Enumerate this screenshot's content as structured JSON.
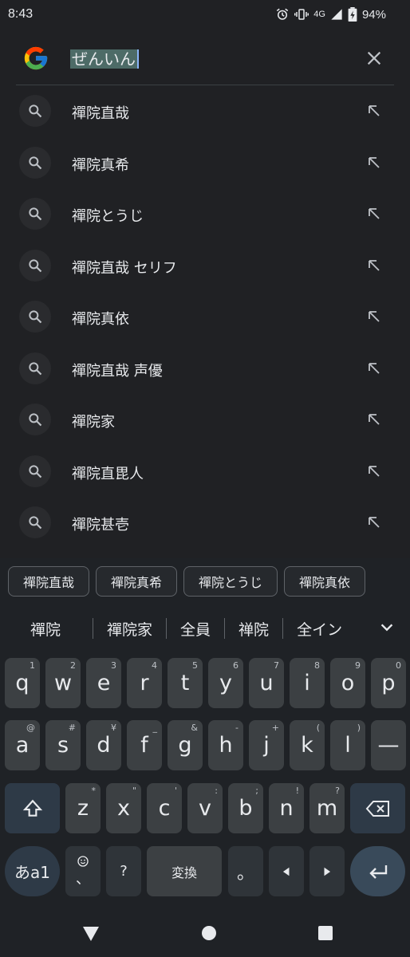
{
  "status": {
    "time": "8:43",
    "network": "4G",
    "battery": "94%"
  },
  "search": {
    "query": "ぜんいん"
  },
  "suggestions": [
    {
      "text": "禪院直哉"
    },
    {
      "text": "禪院真希"
    },
    {
      "text": "禪院とうじ"
    },
    {
      "text": "禪院直哉 セリフ"
    },
    {
      "text": "禪院真依"
    },
    {
      "text": "禪院直哉 声優"
    },
    {
      "text": "禪院家"
    },
    {
      "text": "禪院直毘人"
    },
    {
      "text": "禪院甚壱"
    }
  ],
  "keyboard": {
    "chips": [
      "禪院直哉",
      "禪院真希",
      "禪院とうじ",
      "禪院真依"
    ],
    "candidates": [
      "禪院",
      "禪院家",
      "全員",
      "禅院",
      "全イン"
    ],
    "row1": [
      {
        "k": "q",
        "h": "1"
      },
      {
        "k": "w",
        "h": "2"
      },
      {
        "k": "e",
        "h": "3"
      },
      {
        "k": "r",
        "h": "4"
      },
      {
        "k": "t",
        "h": "5"
      },
      {
        "k": "y",
        "h": "6"
      },
      {
        "k": "u",
        "h": "7"
      },
      {
        "k": "i",
        "h": "8"
      },
      {
        "k": "o",
        "h": "9"
      },
      {
        "k": "p",
        "h": "0"
      }
    ],
    "row2": [
      {
        "k": "a",
        "h": "@"
      },
      {
        "k": "s",
        "h": "#"
      },
      {
        "k": "d",
        "h": "¥"
      },
      {
        "k": "f",
        "h": "_"
      },
      {
        "k": "g",
        "h": "&"
      },
      {
        "k": "h",
        "h": "-"
      },
      {
        "k": "j",
        "h": "+"
      },
      {
        "k": "k",
        "h": "("
      },
      {
        "k": "l",
        "h": ")"
      },
      {
        "k": "—",
        "h": ""
      }
    ],
    "row3": [
      {
        "k": "z",
        "h": "*"
      },
      {
        "k": "x",
        "h": "\""
      },
      {
        "k": "c",
        "h": "'"
      },
      {
        "k": "v",
        "h": ":"
      },
      {
        "k": "b",
        "h": ";"
      },
      {
        "k": "n",
        "h": "!"
      },
      {
        "k": "m",
        "h": "?"
      }
    ],
    "mode_label": "あa1",
    "emoji_comma": "、",
    "question": "?",
    "space_label": "変換",
    "period": "。"
  }
}
